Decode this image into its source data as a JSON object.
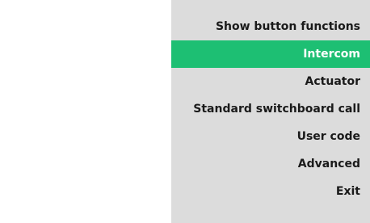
{
  "menu": {
    "items": [
      {
        "label": "Show button functions"
      },
      {
        "label": "Intercom",
        "selected": true
      },
      {
        "label": "Actuator"
      },
      {
        "label": "Standard switchboard call"
      },
      {
        "label": "User code"
      },
      {
        "label": "Advanced"
      },
      {
        "label": "Exit"
      }
    ]
  },
  "colors": {
    "panel_background": "#dcdcdc",
    "selected_background": "#1dbf73",
    "selected_text": "#ffffff",
    "text": "#1a1a1a"
  }
}
